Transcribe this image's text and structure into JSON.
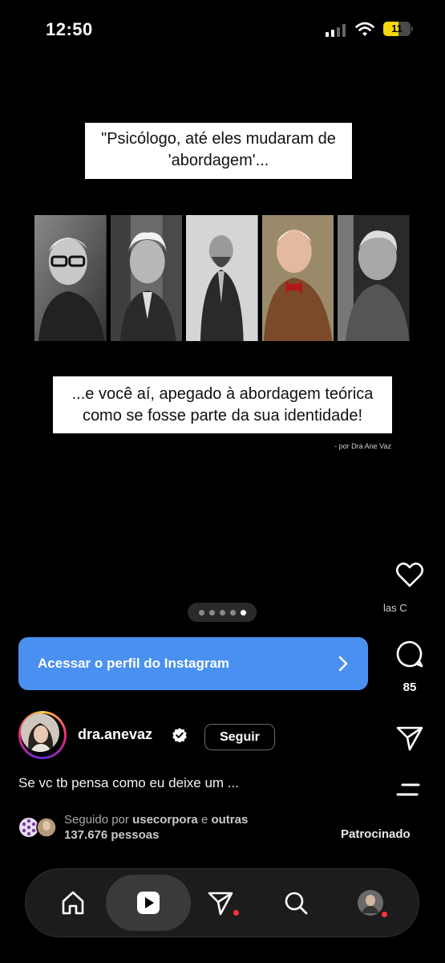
{
  "status_bar": {
    "time": "12:50",
    "battery": "11"
  },
  "post": {
    "quote_top": "\"Psicólogo, até eles mudaram de 'abordagem'...",
    "quote_bottom": "...e você aí, apegado à abordagem teórica como se fosse parte da sua identidade!",
    "credit": "- por Dra Ane Vaz",
    "photos": [
      {
        "icon": "portrait-man-glasses"
      },
      {
        "icon": "portrait-man-white-hair"
      },
      {
        "icon": "portrait-man-beard"
      },
      {
        "icon": "portrait-man-bowtie"
      },
      {
        "icon": "portrait-man-gray-hair"
      }
    ]
  },
  "carousel": {
    "count": 5,
    "active_index": 4
  },
  "actions": {
    "likes_partial": "las   C",
    "comments": "85"
  },
  "cta": {
    "label": "Acessar o perfil do Instagram"
  },
  "profile": {
    "username": "dra.anevaz",
    "follow_label": "Seguir",
    "caption": "Se vc tb pensa como eu deixe um ...",
    "followed_prefix": "Seguido por ",
    "followed_user": "usecorpora",
    "followed_mid": " e ",
    "followed_others": "outras",
    "followed_count": "137.676 pessoas",
    "sponsored": "Patrocinado"
  },
  "nav": {
    "items": [
      "home-icon",
      "reels-icon",
      "send-icon",
      "search-icon",
      "profile-avatar"
    ],
    "active_index": 1
  },
  "colors": {
    "accent": "#4a90f0",
    "badge": "#ff3040",
    "background": "#000000"
  }
}
